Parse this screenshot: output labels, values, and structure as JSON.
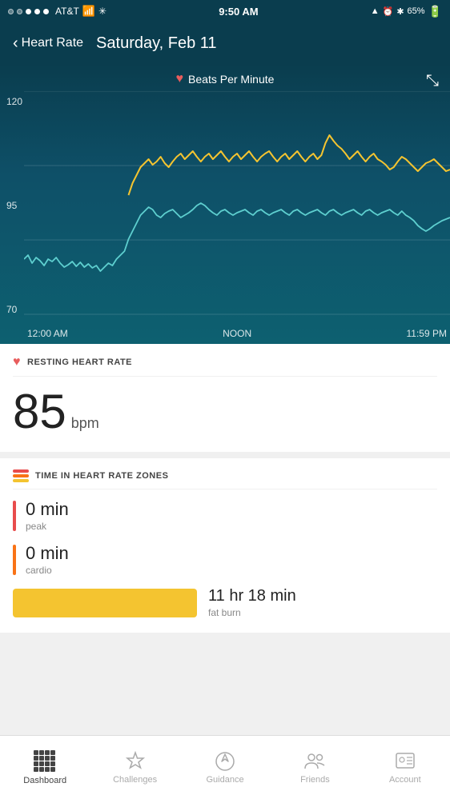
{
  "statusBar": {
    "carrier": "AT&T",
    "time": "9:50 AM",
    "battery": "65%"
  },
  "header": {
    "backLabel": "Heart Rate",
    "title": "Saturday, Feb 11"
  },
  "chart": {
    "legend": "Beats Per Minute",
    "yLabels": [
      "120",
      "95",
      "70"
    ],
    "xLabels": [
      "12:00 AM",
      "NOON",
      "11:59 PM"
    ],
    "gridLines": [
      0,
      1,
      2
    ]
  },
  "restingSection": {
    "title": "RESTING HEART RATE",
    "value": "85",
    "unit": "bpm"
  },
  "zonesSection": {
    "title": "TIME IN HEART RATE ZONES",
    "zones": [
      {
        "label": "peak",
        "value": "0 min",
        "color": "#e84c4c"
      },
      {
        "label": "cardio",
        "value": "0 min",
        "color": "#f97316"
      },
      {
        "label": "fat burn",
        "value": "11 hr 18 min",
        "color": "#f4c430",
        "bar": true
      }
    ]
  },
  "nav": {
    "items": [
      {
        "label": "Dashboard",
        "active": true
      },
      {
        "label": "Challenges",
        "active": false
      },
      {
        "label": "Guidance",
        "active": false
      },
      {
        "label": "Friends",
        "active": false
      },
      {
        "label": "Account",
        "active": false
      }
    ]
  }
}
